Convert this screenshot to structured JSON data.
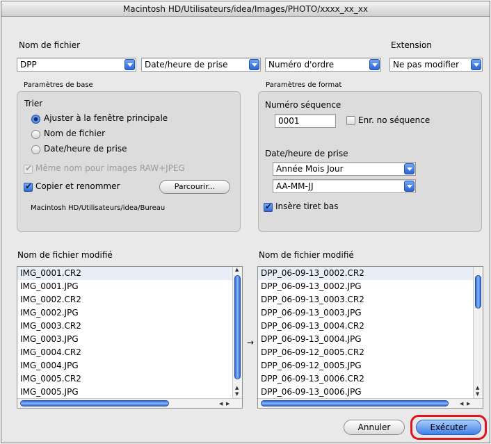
{
  "window": {
    "title": "Macintosh HD/Utilisateurs/idea/Images/PHOTO/xxxx_xx_xx"
  },
  "naming": {
    "nom_label": "Nom de fichier",
    "extension_label": "Extension",
    "field1": "DPP",
    "field2": "Date/heure de prise",
    "field3": "Numéro d'ordre",
    "extension_value": "Ne pas modifier"
  },
  "basic": {
    "title": "Paramètres de base",
    "sort_label": "Trier",
    "options": [
      "Ajuster à la fenêtre principale",
      "Nom de fichier",
      "Date/heure de prise"
    ],
    "selected_index": 0,
    "same_name_label": "Même nom pour images RAW+JPEG",
    "same_name_checked": true,
    "copy_rename_label": "Copier et renommer",
    "copy_rename_checked": true,
    "browse_label": "Parcourir...",
    "path": "Macintosh HD/Utilisateurs/idea/Bureau"
  },
  "format": {
    "title": "Paramètres de format",
    "seq_label": "Numéro séquence",
    "seq_value": "0001",
    "save_seq_label": "Enr. no séquence",
    "save_seq_checked": false,
    "date_label": "Date/heure de prise",
    "date_order": "Année Mois Jour",
    "date_format": "AA-MM-JJ",
    "underscore_label": "Insère tiret bas",
    "underscore_checked": true
  },
  "lists": {
    "left_label": "Nom de fichier modifié",
    "right_label": "Nom de fichier modifié",
    "arrow": "→",
    "left_items": [
      "IMG_0001.CR2",
      "IMG_0001.JPG",
      "IMG_0002.CR2",
      "IMG_0002.JPG",
      "IMG_0003.CR2",
      "IMG_0003.JPG",
      "IMG_0004.CR2",
      "IMG_0004.JPG",
      "IMG_0005.CR2",
      "IMG_0005.JPG"
    ],
    "right_items": [
      "DPP_06-09-13_0002.CR2",
      "DPP_06-09-13_0002.JPG",
      "DPP_06-09-13_0003.CR2",
      "DPP_06-09-13_0003.JPG",
      "DPP_06-09-13_0004.CR2",
      "DPP_06-09-13_0004.JPG",
      "DPP_06-09-12_0005.CR2",
      "DPP_06-09-12_0005.JPG",
      "DPP_06-09-13_0006.CR2",
      "DPP_06-09-13_0006.JPG"
    ]
  },
  "buttons": {
    "cancel": "Annuler",
    "execute": "Exécuter"
  },
  "colors": {
    "accent": "#3f7fe6",
    "highlight": "#e0141c"
  }
}
